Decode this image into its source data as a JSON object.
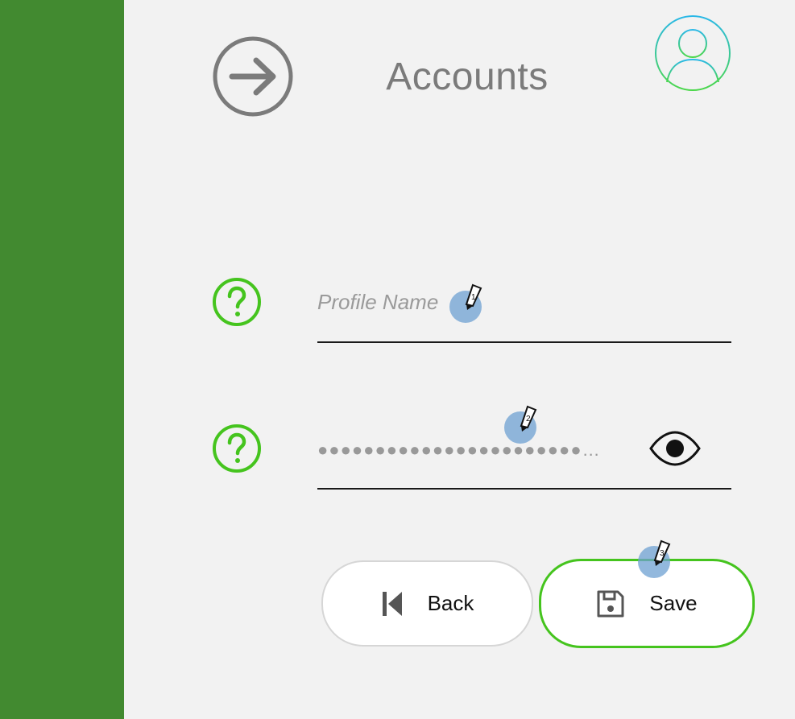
{
  "sidebar": {
    "color": "#428a30"
  },
  "header": {
    "title": "Accounts",
    "nav_icon": "arrow-right-circle-icon",
    "avatar_icon": "user-avatar-icon"
  },
  "form": {
    "profile_name": {
      "placeholder": "Profile Name",
      "value": "",
      "help_icon": "question-circle-icon"
    },
    "password": {
      "masked_value": "●●●●●●●●●●●●●●●●●●●●●●●…",
      "help_icon": "question-circle-icon",
      "toggle_icon": "eye-icon"
    }
  },
  "markers": [
    {
      "label": "1"
    },
    {
      "label": "2"
    },
    {
      "label": "3"
    }
  ],
  "buttons": {
    "back": {
      "label": "Back",
      "icon": "skip-back-icon"
    },
    "save": {
      "label": "Save",
      "icon": "floppy-disk-icon"
    }
  },
  "colors": {
    "accent_green": "#45c41e",
    "sidebar_green": "#428a30",
    "avatar_gradient": [
      "#2ab8e8",
      "#4bd74a"
    ]
  }
}
